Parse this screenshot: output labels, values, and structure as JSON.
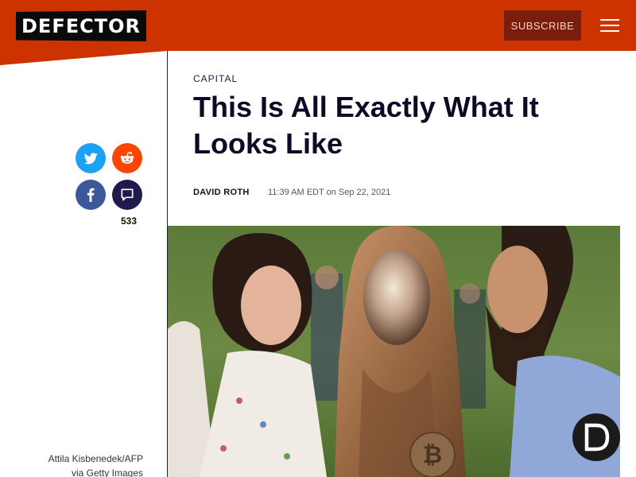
{
  "header": {
    "logo_text": "DEFECTOR",
    "subscribe_label": "SUBSCRIBE",
    "menu_icon": "hamburger-menu-icon",
    "background_color": "#cc3300"
  },
  "share": {
    "twitter_icon": "twitter-icon",
    "reddit_icon": "reddit-icon",
    "facebook_icon": "facebook-icon",
    "comments_icon": "comment-icon",
    "comment_count": "533"
  },
  "article": {
    "category": "CAPITAL",
    "title": "This Is All Exactly What It Looks Like",
    "author": "DAVID ROTH",
    "timestamp": "11:39 AM EDT on Sep 22, 2021",
    "image_caption_line1": "Attila Kisbenedek/AFP",
    "image_caption_line2": "via Getty Images"
  },
  "badge": {
    "letter": "D"
  }
}
